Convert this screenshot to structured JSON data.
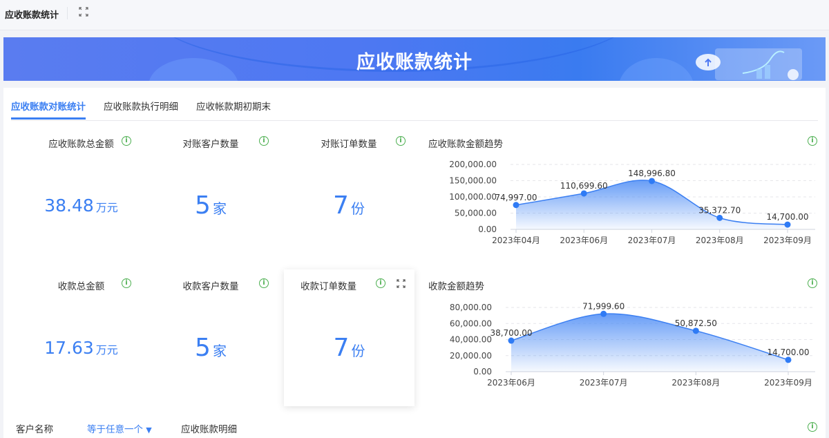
{
  "topbar": {
    "title": "应收账款统计",
    "expand_icon": "expand-icon"
  },
  "banner": {
    "title": "应收账款统计"
  },
  "tabs": [
    {
      "label": "应收账款对账统计",
      "active": true
    },
    {
      "label": "应收账款执行明细",
      "active": false
    },
    {
      "label": "应收帐款期初期末",
      "active": false
    }
  ],
  "kpis": [
    {
      "title": "应收账款总金额",
      "value": "38.48",
      "unit": "万元"
    },
    {
      "title": "对账客户数量",
      "value": "5",
      "unit": "家"
    },
    {
      "title": "对账订单数量",
      "value": "7",
      "unit": "份"
    },
    {
      "title": "收款总金额",
      "value": "17.63",
      "unit": "万元"
    },
    {
      "title": "收款客户数量",
      "value": "5",
      "unit": "家"
    },
    {
      "title": "收款订单数量",
      "value": "7",
      "unit": "份"
    }
  ],
  "info_glyph": "i",
  "expand_glyph": "⛶",
  "filter": {
    "label": "客户名称",
    "operator": "等于任意一个",
    "detail_title": "应收账款明细"
  },
  "colors": {
    "accent": "#3b7ff2",
    "info": "#4caf50"
  },
  "chart_data": [
    {
      "type": "area",
      "title": "应收账款金额趋势",
      "categories": [
        "2023年04月",
        "2023年06月",
        "2023年07月",
        "2023年08月",
        "2023年09月"
      ],
      "values": [
        74997.0,
        110699.6,
        148996.8,
        35372.7,
        14700.0
      ],
      "labels": [
        "74,997.00",
        "110,699.60",
        "148,996.80",
        "35,372.70",
        "14,700.00"
      ],
      "yticks": [
        "0.00",
        "50,000.00",
        "100,000.00",
        "150,000.00",
        "200,000.00"
      ],
      "ylim": [
        0,
        200000
      ]
    },
    {
      "type": "area",
      "title": "收款金额趋势",
      "categories": [
        "2023年06月",
        "2023年07月",
        "2023年08月",
        "2023年09月"
      ],
      "values": [
        38700.0,
        71999.6,
        50872.5,
        14700.0
      ],
      "labels": [
        "38,700.00",
        "71,999.60",
        "50,872.50",
        "14,700.00"
      ],
      "yticks": [
        "0.00",
        "20,000.00",
        "40,000.00",
        "60,000.00",
        "80,000.00"
      ],
      "ylim": [
        0,
        80000
      ]
    }
  ]
}
